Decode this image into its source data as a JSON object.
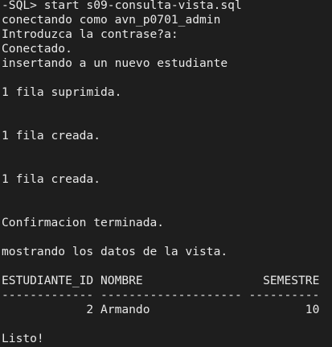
{
  "terminal": {
    "lines": [
      "-SQL> start s09-consulta-vista.sql",
      "conectando como avn_p0701_admin",
      "Introduzca la contrase?a:",
      "Conectado.",
      "insertando a un nuevo estudiante",
      "",
      "1 fila suprimida.",
      "",
      "",
      "1 fila creada.",
      "",
      "",
      "1 fila creada.",
      "",
      "",
      "Confirmacion terminada.",
      "",
      "mostrando los datos de la vista.",
      "",
      "ESTUDIANTE_ID NOMBRE                 SEMESTRE",
      "------------- -------------------- ----------",
      "            2 Armando                      10",
      "",
      "Listo!"
    ]
  },
  "colors": {
    "background": "#1e1e1e",
    "foreground": "#e8e8e8"
  }
}
